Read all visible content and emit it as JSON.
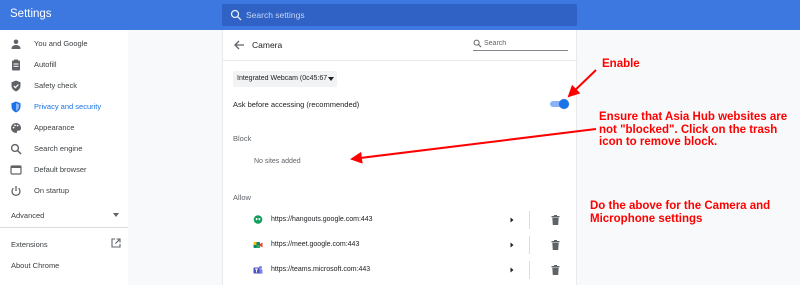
{
  "app": {
    "title": "Settings"
  },
  "search": {
    "placeholder": "Search settings"
  },
  "sidebar": {
    "items": [
      {
        "label": "You and Google",
        "icon": "person-icon"
      },
      {
        "label": "Autofill",
        "icon": "clipboard-icon"
      },
      {
        "label": "Safety check",
        "icon": "shield-check-icon"
      },
      {
        "label": "Privacy and security",
        "icon": "shield-icon",
        "active": true
      },
      {
        "label": "Appearance",
        "icon": "palette-icon"
      },
      {
        "label": "Search engine",
        "icon": "search-icon"
      },
      {
        "label": "Default browser",
        "icon": "browser-icon"
      },
      {
        "label": "On startup",
        "icon": "power-icon"
      }
    ],
    "advanced": "Advanced",
    "extensions": "Extensions",
    "about": "About Chrome"
  },
  "camera": {
    "title": "Camera",
    "search_placeholder": "Search",
    "device": "Integrated Webcam (0c45:672",
    "ask_label": "Ask before accessing (recommended)",
    "ask_enabled": true,
    "block_title": "Block",
    "no_sites": "No sites added",
    "allow_title": "Allow",
    "allow_sites": [
      {
        "url": "https://hangouts.google.com:443",
        "icon": "hangouts-icon"
      },
      {
        "url": "https://meet.google.com:443",
        "icon": "meet-icon"
      },
      {
        "url": "https://teams.microsoft.com:443",
        "icon": "teams-icon"
      }
    ]
  },
  "annotations": {
    "enable": "Enable",
    "ensure": "Ensure that Asia Hub websites are not \"blocked\". Click on the trash icon to remove block.",
    "do_above": "Do the above for the Camera and Microphone settings",
    "color": "#ff0000"
  },
  "colors": {
    "accent": "#1a73e8",
    "topbar": "#3c78e0"
  }
}
